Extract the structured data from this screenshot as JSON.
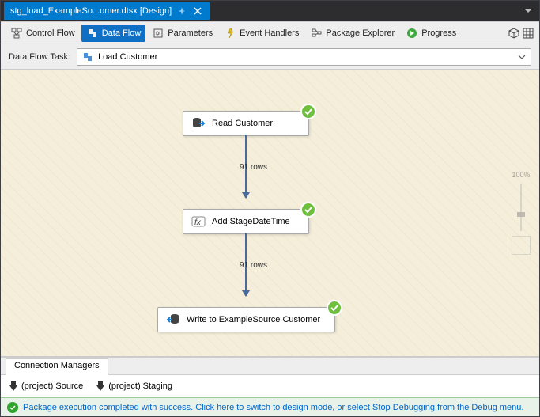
{
  "tab": {
    "title": "stg_load_ExampleSo...omer.dtsx [Design]"
  },
  "toolbar": {
    "control_flow": "Control Flow",
    "data_flow": "Data Flow",
    "parameters": "Parameters",
    "event_handlers": "Event Handlers",
    "package_explorer": "Package Explorer",
    "progress": "Progress"
  },
  "task": {
    "label": "Data Flow Task:",
    "value": "Load Customer"
  },
  "nodes": {
    "read": "Read Customer",
    "add": "Add StageDateTime",
    "write": "Write to ExampleSource Customer"
  },
  "flows": {
    "rows1": "91 rows",
    "rows2": "91 rows"
  },
  "zoom": {
    "pct": "100%"
  },
  "conn": {
    "tab": "Connection Managers",
    "source": "(project) Source",
    "staging": "(project) Staging"
  },
  "status": {
    "msg": "Package execution completed with success. Click here to switch to design mode, or select Stop Debugging from the Debug menu."
  }
}
